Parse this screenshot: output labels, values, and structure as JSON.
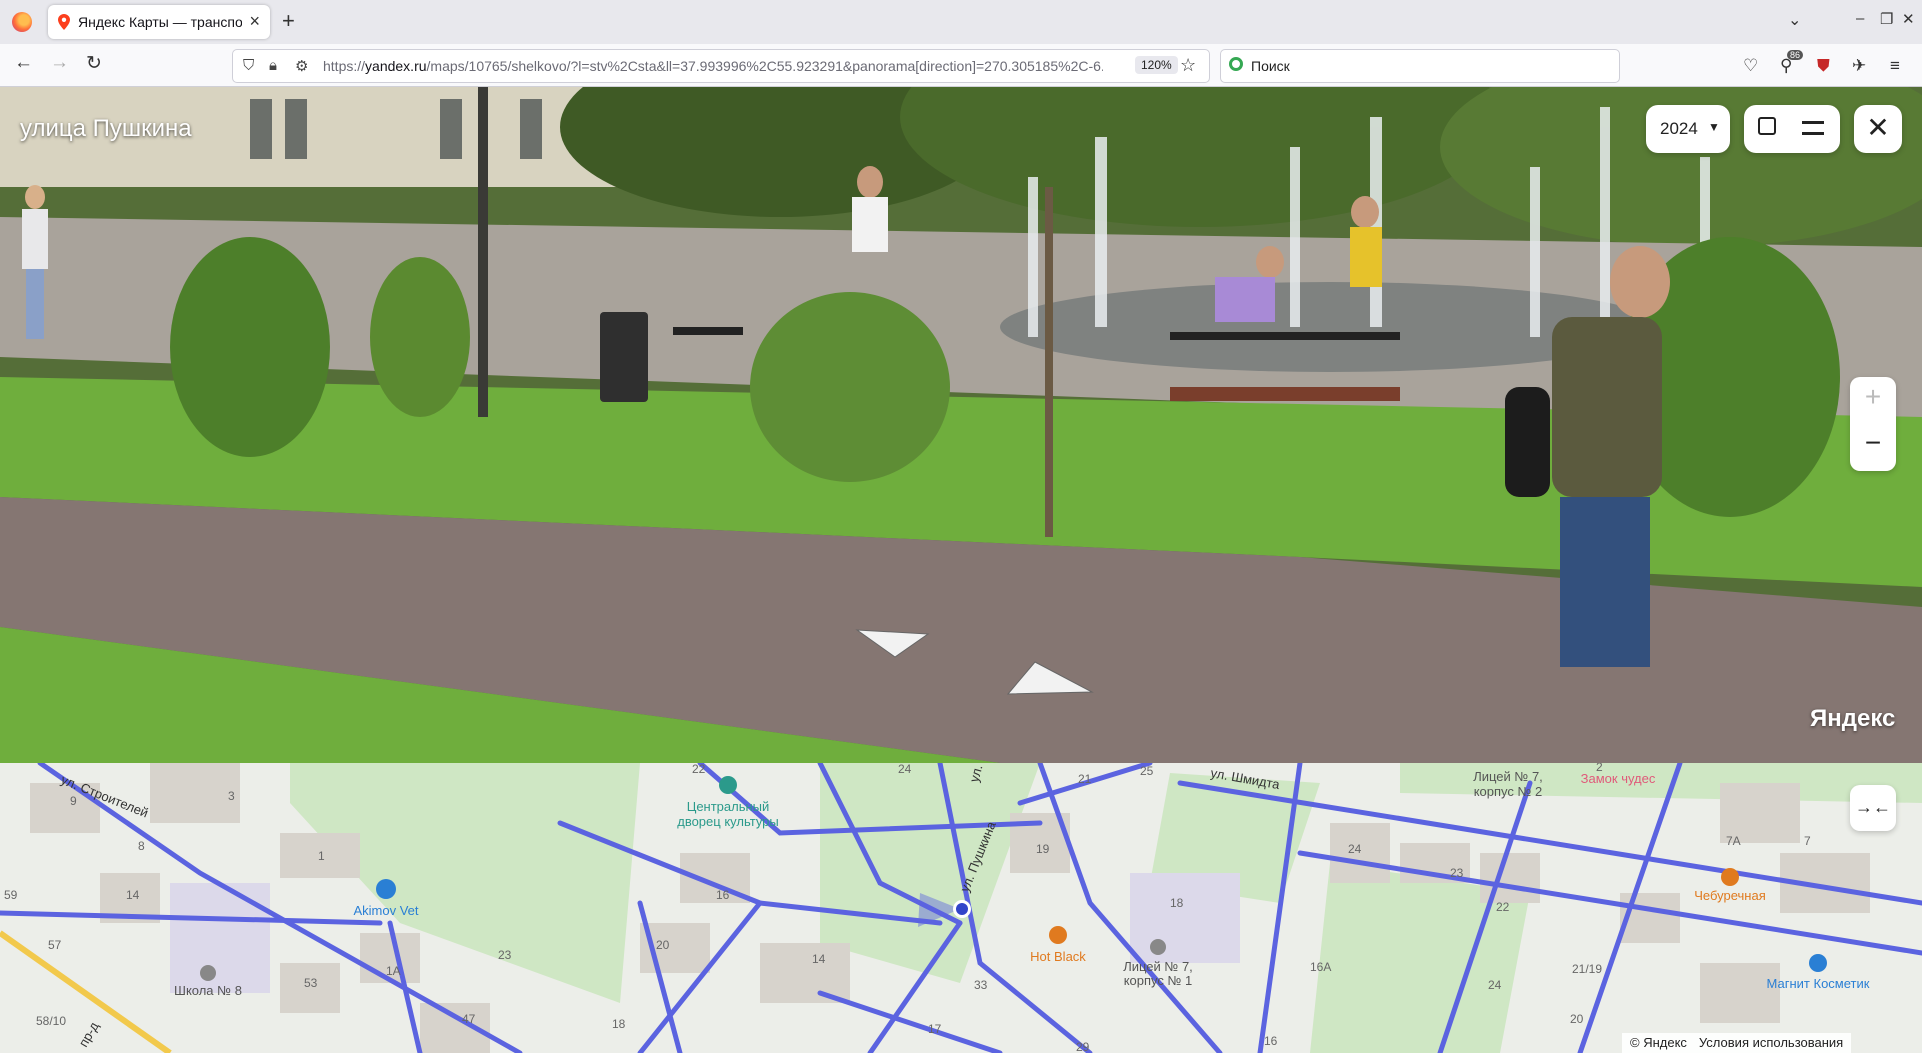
{
  "browser": {
    "tab_title": "Яндекс Карты — транспор",
    "url_prefix": "https://",
    "url_domain": "yandex.ru",
    "url_path": "/maps/10765/shelkovo/?l=stv%2Csta&ll=37.993996%2C55.923291&panorama[direction]=270.305185%2C-6.",
    "zoom_level": "120%",
    "search_placeholder": "Поиск",
    "extension_badge": "86"
  },
  "panorama": {
    "street_name": "улица Пушкина",
    "year": "2024",
    "logo": "Яндекс"
  },
  "map": {
    "streets": [
      {
        "label": "ул. Строителей"
      },
      {
        "label": "ул. Пушкина"
      },
      {
        "label": "ул. Шмидта"
      },
      {
        "label": "ул."
      },
      {
        "label": "пр-д"
      }
    ],
    "pois": [
      {
        "label": "Центральный",
        "label2": "дворец культуры",
        "color": "#2b9a8b"
      },
      {
        "label": "Akimov Vet",
        "color": "#2a7fd4"
      },
      {
        "label": "Школа № 8",
        "color": "#555555"
      },
      {
        "label": "Hot Black",
        "color": "#e07a1f"
      },
      {
        "label": "Лицей № 7,",
        "label2": "корпус № 1",
        "color": "#555555"
      },
      {
        "label": "Лицей № 7,",
        "label2": "корпус № 2",
        "color": "#555555"
      },
      {
        "label": "Замок чудес",
        "color": "#e05a7a"
      },
      {
        "label": "Чебуречная",
        "color": "#e07a1f"
      },
      {
        "label": "Магнит Косметик",
        "color": "#2a7fd4"
      }
    ],
    "house_numbers": [
      "22",
      "24",
      "25",
      "21",
      "3",
      "9",
      "8",
      "1",
      "14",
      "59",
      "57",
      "58/10",
      "53",
      "1А",
      "47",
      "23",
      "16",
      "20",
      "14",
      "18",
      "19",
      "18",
      "33",
      "17",
      "29",
      "16",
      "24",
      "23",
      "22",
      "24",
      "16А",
      "21/19",
      "20",
      "7А",
      "7",
      "2"
    ],
    "copyright": "© Яндекс",
    "terms": "Условия использования"
  },
  "colors": {
    "street_blue": "#5b63e0",
    "poi_teal": "#2b9a8b",
    "poi_orange": "#e07a1f"
  },
  "icons": [
    "firefox-logo-icon",
    "map-pin-icon",
    "close-icon",
    "plus-icon",
    "chevron-down-icon",
    "back-icon",
    "forward-icon",
    "reload-icon",
    "shield-icon",
    "lock-icon",
    "star-icon",
    "pocket-icon",
    "extensions-icon",
    "menu-icon",
    "external-link-icon",
    "collapse-icon"
  ]
}
